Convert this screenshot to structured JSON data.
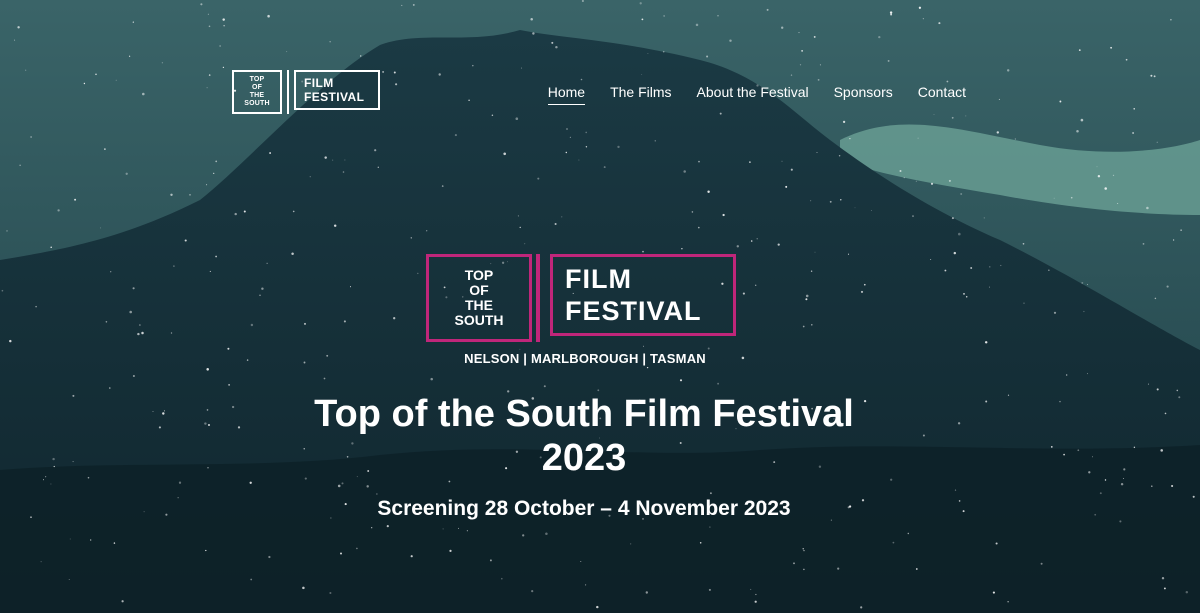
{
  "header": {
    "logo": {
      "left_lines": [
        "TOP",
        "OF",
        "THE",
        "SOUTH"
      ],
      "right_lines": [
        "FILM",
        "FESTIVAL"
      ]
    },
    "nav": [
      {
        "label": "Home",
        "active": true
      },
      {
        "label": "The Films",
        "active": false
      },
      {
        "label": "About the Festival",
        "active": false
      },
      {
        "label": "Sponsors",
        "active": false
      },
      {
        "label": "Contact",
        "active": false
      }
    ]
  },
  "hero": {
    "logo": {
      "left_lines": [
        "TOP",
        "OF",
        "THE",
        "SOUTH"
      ],
      "right_lines": [
        "FILM",
        "FESTIVAL"
      ],
      "regions": "NELSON | MARLBOROUGH | TASMAN"
    },
    "title_line1": "Top of the South Film Festival",
    "title_line2": "2023",
    "dates": "Screening 28 October – 4 November 2023"
  },
  "colors": {
    "accent": "#c0267a",
    "sky": "#2f5a5e",
    "mountain": "#16303a",
    "aurora": "#6fa59a"
  },
  "icons": {}
}
